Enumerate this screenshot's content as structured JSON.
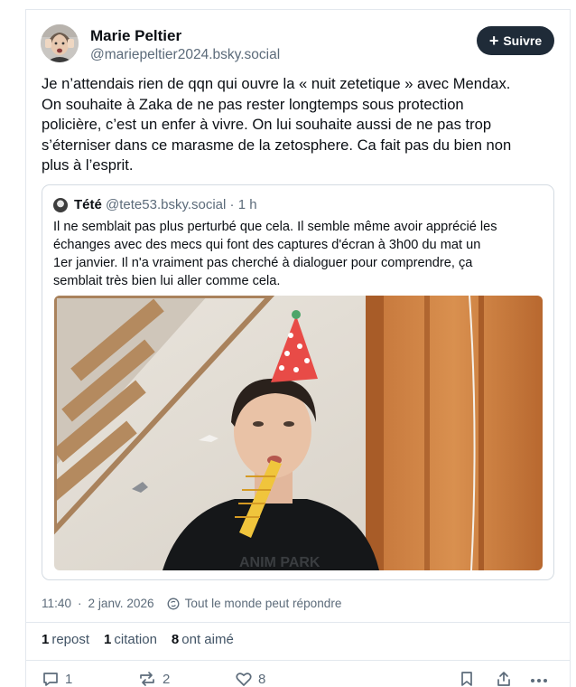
{
  "author": {
    "name": "Marie Peltier",
    "handle": "@mariepeltier2024.bsky.social"
  },
  "follow_button": {
    "label": "Suivre",
    "icon": "plus-icon"
  },
  "post": {
    "lines": [
      "Je n’attendais rien de qqn qui ouvre la « nuit zetetique » avec Mendax.",
      "On souhaite à Zaka de ne pas rester longtemps sous protection",
      "policière, c’est un enfer à vivre. On lui souhaite aussi de ne pas trop",
      "s’éterniser dans ce marasme de la zetosphere. Ca fait pas du bien non",
      "plus à l’esprit."
    ]
  },
  "quote": {
    "name": "Tété",
    "handle": "@tete53.bsky.social",
    "separator": "·",
    "time": "1 h",
    "lines": [
      "Il ne semblait pas plus perturbé que cela. Il semble même avoir apprécié les",
      "échanges avec des mecs qui font des captures d'écran à 3h00 du mat un",
      "1er janvier. Il n'a vraiment pas cherché à dialoguer pour comprendre, ça",
      "semblait très bien lui aller comme cela."
    ]
  },
  "meta": {
    "time": "11:40",
    "separator": "·",
    "date": "2 janv. 2026",
    "reply_setting": "Tout le monde peut répondre",
    "reply_icon": "globe-icon"
  },
  "stats": {
    "reposts_count": "1",
    "reposts_label": "repost",
    "quotes_count": "1",
    "quotes_label": "citation",
    "likes_count": "8",
    "likes_label": "ont aimé"
  },
  "actions": {
    "reply_count": "1",
    "repost_count": "2",
    "like_count": "8",
    "icons": [
      "comment-icon",
      "repost-icon",
      "heart-icon",
      "bookmark-icon",
      "share-icon",
      "more-icon"
    ]
  },
  "colors": {
    "follow_bg": "#1f2b38",
    "muted_text": "#5c6b7a",
    "border": "#d4dbe2"
  }
}
